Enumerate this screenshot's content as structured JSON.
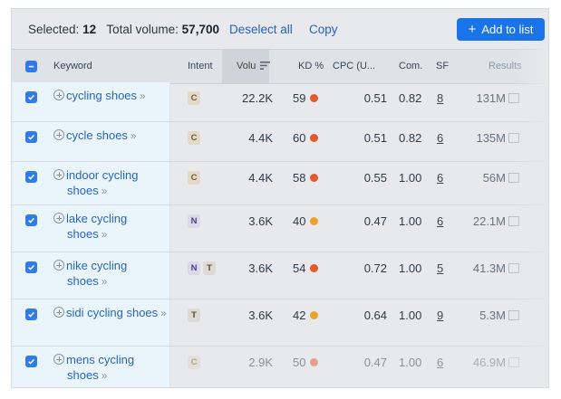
{
  "toolbar": {
    "selected_label": "Selected:",
    "selected_count": "12",
    "total_label": "Total volume:",
    "total_value": "57,700",
    "deselect_label": "Deselect all",
    "copy_label": "Copy",
    "add_label": "Add to list"
  },
  "columns": {
    "keyword": "Keyword",
    "intent": "Intent",
    "volume": "Volu",
    "kd": "KD %",
    "cpc": "CPC (U...",
    "com": "Com.",
    "sf": "SF",
    "results": "Results"
  },
  "colors": {
    "accent": "#1a73e8",
    "kd_red": "#e05a2a",
    "kd_orange": "#eaa22b"
  },
  "rows": [
    {
      "keyword": "cycling shoes",
      "intent": [
        "C"
      ],
      "volume": "22.2K",
      "kd": "59",
      "kd_color": "#e05a2a",
      "cpc": "0.51",
      "com": "0.82",
      "sf": "8",
      "results": "131M"
    },
    {
      "keyword": "cycle shoes",
      "intent": [
        "C"
      ],
      "volume": "4.4K",
      "kd": "60",
      "kd_color": "#e05a2a",
      "cpc": "0.51",
      "com": "0.82",
      "sf": "6",
      "results": "135M"
    },
    {
      "keyword": "indoor cycling shoes",
      "intent": [
        "C"
      ],
      "volume": "4.4K",
      "kd": "58",
      "kd_color": "#e05a2a",
      "cpc": "0.55",
      "com": "1.00",
      "sf": "6",
      "results": "56M"
    },
    {
      "keyword": "lake cycling shoes",
      "intent": [
        "N"
      ],
      "volume": "3.6K",
      "kd": "40",
      "kd_color": "#eaa22b",
      "cpc": "0.47",
      "com": "1.00",
      "sf": "6",
      "results": "22.1M"
    },
    {
      "keyword": "nike cycling shoes",
      "intent": [
        "N",
        "T"
      ],
      "volume": "3.6K",
      "kd": "54",
      "kd_color": "#e05a2a",
      "cpc": "0.72",
      "com": "1.00",
      "sf": "5",
      "results": "41.3M"
    },
    {
      "keyword": "sidi cycling shoes",
      "intent": [
        "T"
      ],
      "volume": "3.6K",
      "kd": "42",
      "kd_color": "#eaa22b",
      "cpc": "0.64",
      "com": "1.00",
      "sf": "9",
      "results": "5.3M"
    },
    {
      "keyword": "mens cycling shoes",
      "intent": [
        "C"
      ],
      "volume": "2.9K",
      "kd": "50",
      "kd_color": "#e05a2a",
      "cpc": "0.47",
      "com": "1.00",
      "sf": "6",
      "results": "46.9M"
    }
  ]
}
